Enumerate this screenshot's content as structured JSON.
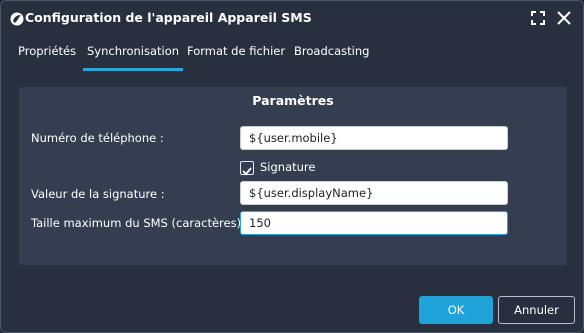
{
  "window": {
    "title": "Configuration de l'appareil Appareil SMS"
  },
  "tabs": [
    {
      "label": "Propriétés",
      "active": false
    },
    {
      "label": "Synchronisation",
      "active": true
    },
    {
      "label": "Format de fichier",
      "active": false
    },
    {
      "label": "Broadcasting",
      "active": false
    }
  ],
  "panel": {
    "title": "Paramètres",
    "phone_label": "Numéro de téléphone :",
    "phone_value": "${user.mobile}",
    "signature_checkbox_label": "Signature",
    "signature_checked": true,
    "signature_value_label": "Valeur de la signature :",
    "signature_value": "${user.displayName}",
    "max_size_label": "Taille maximum du SMS (caractères) :",
    "max_size_value": "150"
  },
  "footer": {
    "ok_label": "OK",
    "cancel_label": "Annuler"
  },
  "colors": {
    "accent": "#1fa3d8",
    "window_bg": "#28303f",
    "panel_bg": "#343e50"
  },
  "icons": {
    "app": "app-logo-icon",
    "maximize": "maximize-icon",
    "close": "close-icon",
    "checkbox": "checkmark-icon"
  }
}
